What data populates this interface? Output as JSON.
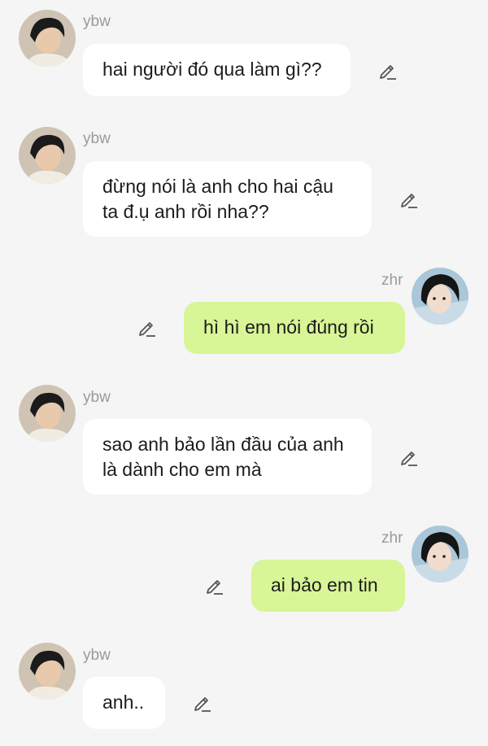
{
  "messages": [
    {
      "sender": "ybw",
      "text": "hai người đó qua làm gì??",
      "edit_icon": "pencil-icon"
    },
    {
      "sender": "ybw",
      "text": "đừng nói là anh cho hai cậu ta đ.ụ anh rồi nha??",
      "edit_icon": "pencil-icon"
    },
    {
      "sender": "zhr",
      "text": "hì hì em nói đúng rồi",
      "edit_icon": "pencil-icon"
    },
    {
      "sender": "ybw",
      "text": "sao anh bảo lần đầu của anh là dành cho em mà",
      "edit_icon": "pencil-icon"
    },
    {
      "sender": "zhr",
      "text": "ai bảo em tin",
      "edit_icon": "pencil-icon"
    },
    {
      "sender": "ybw",
      "text": "anh..",
      "edit_icon": "pencil-icon"
    }
  ],
  "colors": {
    "background": "#f5f5f5",
    "incoming_bubble": "#ffffff",
    "outgoing_bubble": "#d8f597",
    "name_text": "#9a9a9a"
  }
}
